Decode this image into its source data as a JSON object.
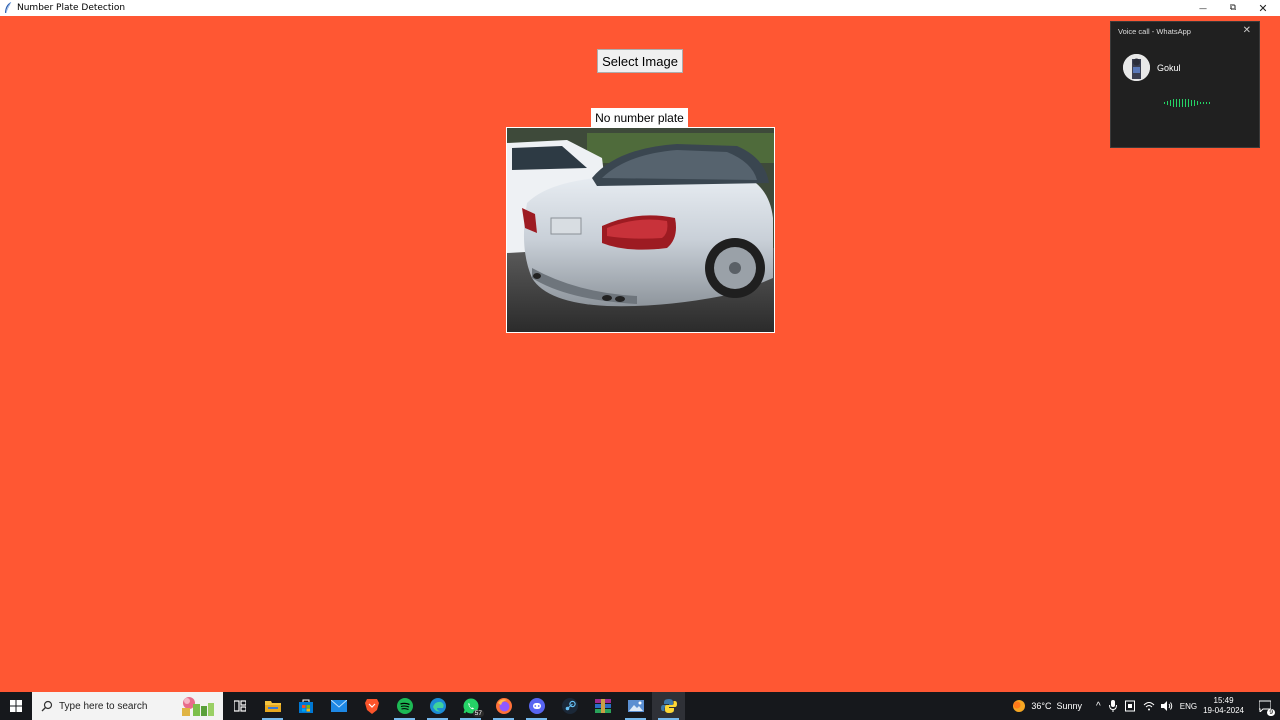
{
  "window": {
    "title": "Number Plate Detection",
    "controls": {
      "minimize": "—",
      "restore": "⧉",
      "close": "✕"
    }
  },
  "app": {
    "background": "#ff5733",
    "select_button_label": "Select Image",
    "result_label": "No number plate",
    "image_icon": "car-photo"
  },
  "notification": {
    "title": "Voice call - WhatsApp",
    "caller": "Gokul",
    "close_icon": "close-icon"
  },
  "taskbar": {
    "search_placeholder": "Type here to search",
    "apps": [
      {
        "name": "task-view-icon"
      },
      {
        "name": "file-explorer-icon"
      },
      {
        "name": "microsoft-store-icon"
      },
      {
        "name": "mail-icon"
      },
      {
        "name": "brave-icon"
      },
      {
        "name": "spotify-icon"
      },
      {
        "name": "edge-icon"
      },
      {
        "name": "whatsapp-icon",
        "badge": "57"
      },
      {
        "name": "firefox-icon"
      },
      {
        "name": "discord-icon"
      },
      {
        "name": "steam-icon"
      },
      {
        "name": "winrar-icon"
      },
      {
        "name": "photo-app-icon"
      },
      {
        "name": "python-icon"
      }
    ],
    "weather": {
      "temp": "36°C",
      "condition": "Sunny"
    },
    "language": "ENG",
    "time": "15:49",
    "date": "19-04-2024",
    "notification_count": "9"
  }
}
